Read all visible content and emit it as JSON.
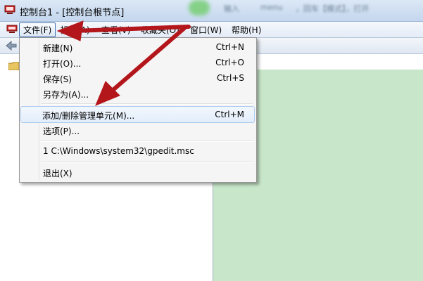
{
  "window": {
    "title": "控制台1 - [控制台根节点]",
    "blurred_text": [
      "输入",
      "menu",
      "，回车【模式】，打开"
    ]
  },
  "menubar": {
    "items": [
      {
        "label": "文件(F)"
      },
      {
        "label": "操作(A)"
      },
      {
        "label": "查看(V)"
      },
      {
        "label": "收藏夹(O)"
      },
      {
        "label": "窗口(W)"
      },
      {
        "label": "帮助(H)"
      }
    ]
  },
  "file_menu": {
    "items": [
      {
        "label": "新建(N)",
        "shortcut": "Ctrl+N"
      },
      {
        "label": "打开(O)...",
        "shortcut": "Ctrl+O"
      },
      {
        "label": "保存(S)",
        "shortcut": "Ctrl+S"
      },
      {
        "label": "另存为(A)...",
        "shortcut": ""
      },
      {
        "label": "添加/删除管理单元(M)...",
        "shortcut": "Ctrl+M"
      },
      {
        "label": "选项(P)...",
        "shortcut": ""
      },
      {
        "label": "1 C:\\Windows\\system32\\gpedit.msc",
        "shortcut": ""
      },
      {
        "label": "退出(X)",
        "shortcut": ""
      }
    ],
    "highlighted_item": "添加/删除管理单元(M)..."
  },
  "colors": {
    "annotation_arrow": "#b3161b",
    "right_pane": "#c8e6c9",
    "menu_bg": "#f5f5f5"
  },
  "icons": [
    "mmc-console-icon",
    "back-arrow-icon",
    "folder-icon"
  ]
}
